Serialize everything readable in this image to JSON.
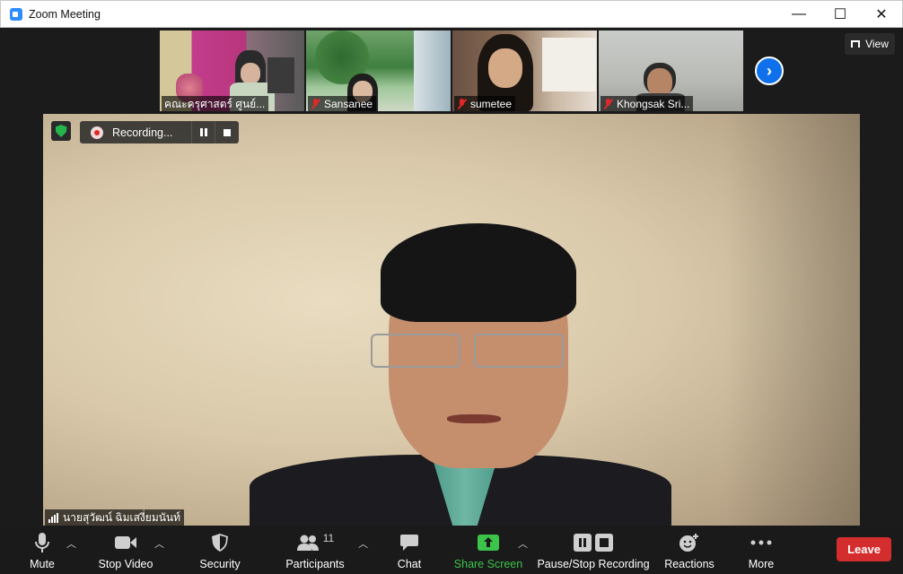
{
  "window": {
    "title": "Zoom Meeting",
    "minimize": "—",
    "maximize": "☐",
    "close": "✕"
  },
  "gallery": {
    "thumbnails": [
      {
        "name": "คณะครุศาสตร์ ศูนย์...",
        "muted": false
      },
      {
        "name": "Sansanee",
        "muted": true
      },
      {
        "name": "sumetee",
        "muted": true
      },
      {
        "name": "Khongsak Sri...",
        "muted": true
      }
    ],
    "view_label": "View"
  },
  "recording": {
    "label": "Recording..."
  },
  "active_speaker": {
    "name": "นายสุวัฒน์ ฉิมเสงี่ยมนันท์"
  },
  "toolbar": {
    "mute": "Mute",
    "stop_video": "Stop Video",
    "security": "Security",
    "participants": "Participants",
    "participant_count": "11",
    "chat": "Chat",
    "share_screen": "Share Screen",
    "pause_stop_recording": "Pause/Stop Recording",
    "reactions": "Reactions",
    "more": "More",
    "leave": "Leave"
  },
  "colors": {
    "accent": "#0e71eb",
    "share": "#3cc34a",
    "leave": "#d42d2d",
    "secure": "#25b34b"
  }
}
